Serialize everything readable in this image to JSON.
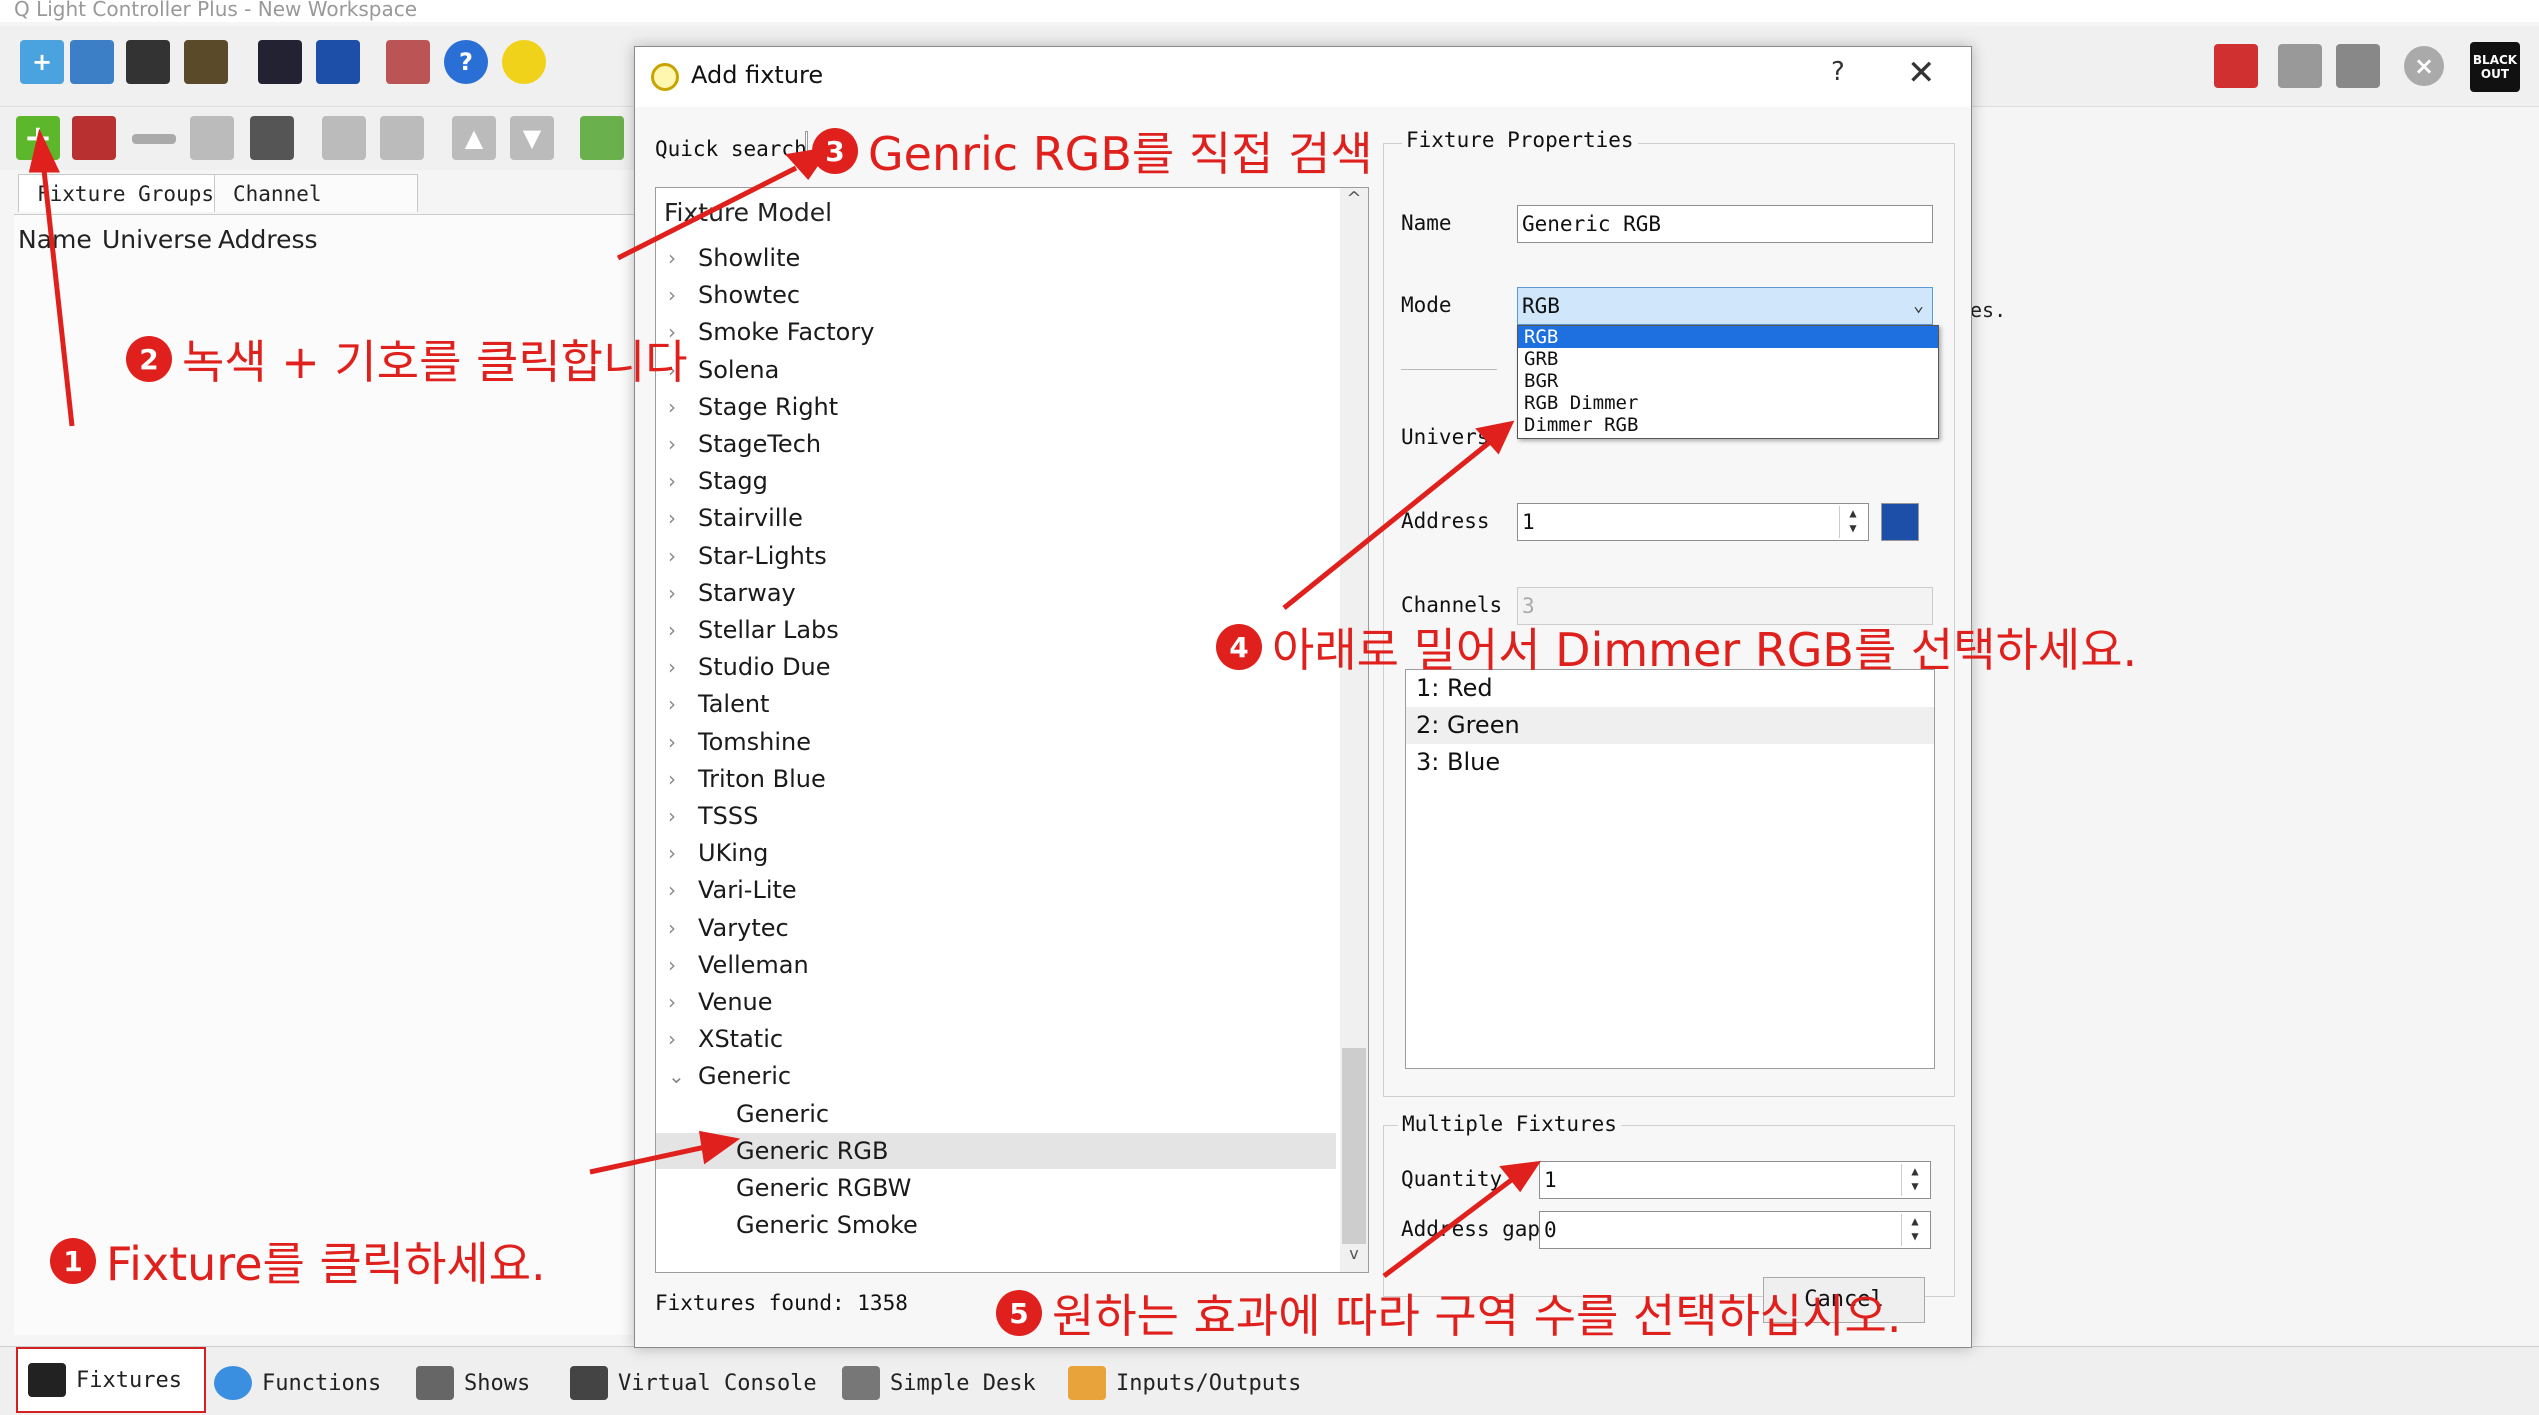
{
  "app": {
    "title": "Q Light Controller Plus - New Workspace",
    "blackout_label": "BLACK OUT"
  },
  "left_panel": {
    "tabs": [
      "Fixture Groups",
      "Channel Groups"
    ],
    "columns": [
      "Name",
      "Universe",
      "Address"
    ]
  },
  "bottom_tabs": [
    "Fixtures",
    "Functions",
    "Shows",
    "Virtual Console",
    "Simple Desk",
    "Inputs/Outputs"
  ],
  "dialog": {
    "title": "Add fixture",
    "help": "?",
    "close": "✕",
    "quick_search_label": "Quick search",
    "tree_header": "Fixture Model",
    "manufacturers": [
      "Showlite",
      "Showtec",
      "Smoke Factory",
      "Solena",
      "Stage Right",
      "StageTech",
      "Stagg",
      "Stairville",
      "Star-Lights",
      "Starway",
      "Stellar Labs",
      "Studio Due",
      "Talent",
      "Tomshine",
      "Triton Blue",
      "TSSS",
      "UKing",
      "Vari-Lite",
      "Varytec",
      "Velleman",
      "Venue",
      "XStatic"
    ],
    "expanded_group": "Generic",
    "generic_children": [
      "Generic",
      "Generic RGB",
      "Generic RGBW",
      "Generic Smoke"
    ],
    "selected_child_index": 1,
    "fixtures_found": "Fixtures found: 1358",
    "properties": {
      "group_title": "Fixture Properties",
      "name_label": "Name",
      "name_value": "Generic RGB",
      "mode_label": "Mode",
      "mode_value": "RGB",
      "mode_options": [
        "RGB",
        "GRB",
        "BGR",
        "RGB Dimmer",
        "Dimmer RGB"
      ],
      "universe_label": "Universe",
      "address_label": "Address",
      "address_value": "1",
      "channels_label": "Channels",
      "channels_value": "3",
      "channel_list": [
        "1: Red",
        "2: Green",
        "3: Blue"
      ]
    },
    "multiple": {
      "group_title": "Multiple Fixtures",
      "quantity_label": "Quantity",
      "quantity_value": "1",
      "gap_label": "Address gap",
      "gap_value": "0"
    },
    "cancel_label": "Cancel"
  },
  "side_text": "es.",
  "annotations": {
    "a1": {
      "num": "1",
      "text": "Fixture를 클릭하세요."
    },
    "a2": {
      "num": "2",
      "text": "녹색 + 기호를 클릭합니다"
    },
    "a3": {
      "num": "3",
      "text": "Genric RGB를 직접 검색"
    },
    "a4": {
      "num": "4",
      "text": "아래로 밀어서 Dimmer RGB를 선택하세요."
    },
    "a5": {
      "num": "5",
      "text": "원하는 효과에 따라 구역 수를 선택하십시오."
    }
  },
  "colors": {
    "annotation": "#e0201c",
    "selection": "#1e6fe0"
  }
}
